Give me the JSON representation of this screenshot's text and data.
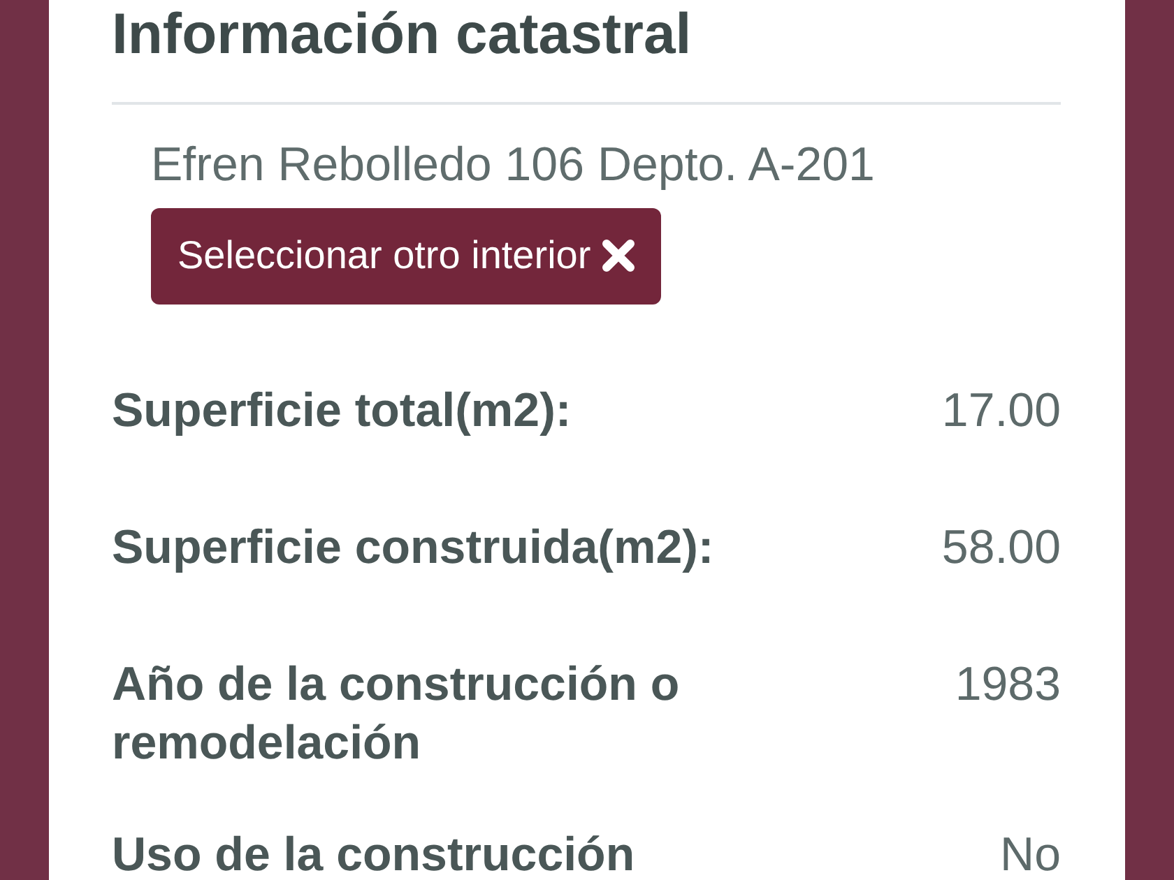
{
  "dialog": {
    "title": "Información catastral"
  },
  "selection": {
    "address": "Efren Rebolledo 106 Depto. A-201",
    "button": {
      "label": "Seleccionar otro interior"
    }
  },
  "fields": [
    {
      "label": "Superficie total(m2):",
      "value": "17.00"
    },
    {
      "label": "Superficie construida(m2):",
      "value": "58.00"
    },
    {
      "label": "Año de la construcción o remodelación",
      "value": "1983"
    },
    {
      "label": "Uso de la construcción",
      "value": "No"
    }
  ]
}
